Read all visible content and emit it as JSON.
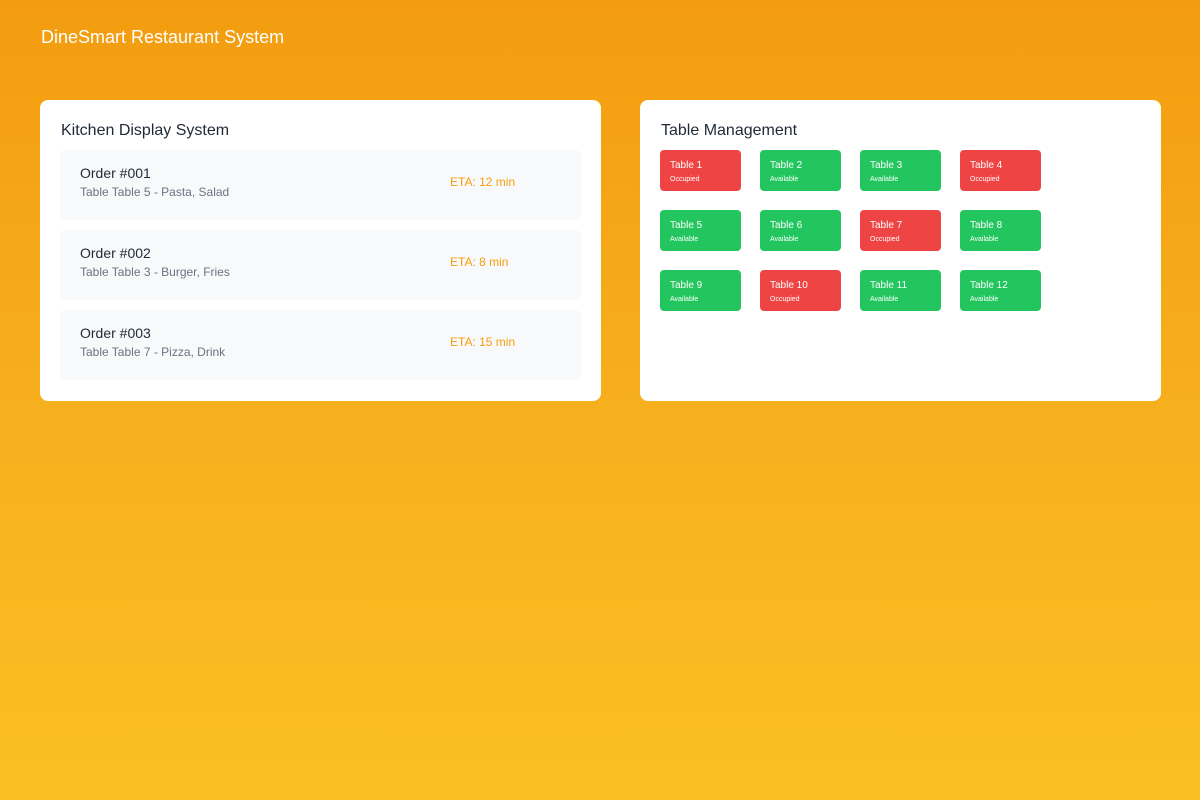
{
  "app": {
    "title": "DineSmart Restaurant System"
  },
  "colors": {
    "occupied": "#ef4444",
    "available": "#22c55e",
    "eta": "#f59e0b"
  },
  "kitchen": {
    "title": "Kitchen Display System",
    "orders": [
      {
        "title": "Order #001",
        "detail": "Table Table 5 - Pasta, Salad",
        "eta": "ETA: 12 min"
      },
      {
        "title": "Order #002",
        "detail": "Table Table 3 - Burger, Fries",
        "eta": "ETA: 8 min"
      },
      {
        "title": "Order #003",
        "detail": "Table Table 7 - Pizza, Drink",
        "eta": "ETA: 15 min"
      }
    ]
  },
  "tables": {
    "title": "Table Management",
    "items": [
      {
        "name": "Table 1",
        "status": "Occupied"
      },
      {
        "name": "Table 2",
        "status": "Available"
      },
      {
        "name": "Table 3",
        "status": "Available"
      },
      {
        "name": "Table 4",
        "status": "Occupied"
      },
      {
        "name": "Table 5",
        "status": "Available"
      },
      {
        "name": "Table 6",
        "status": "Available"
      },
      {
        "name": "Table 7",
        "status": "Occupied"
      },
      {
        "name": "Table 8",
        "status": "Available"
      },
      {
        "name": "Table 9",
        "status": "Available"
      },
      {
        "name": "Table 10",
        "status": "Occupied"
      },
      {
        "name": "Table 11",
        "status": "Available"
      },
      {
        "name": "Table 12",
        "status": "Available"
      }
    ]
  }
}
